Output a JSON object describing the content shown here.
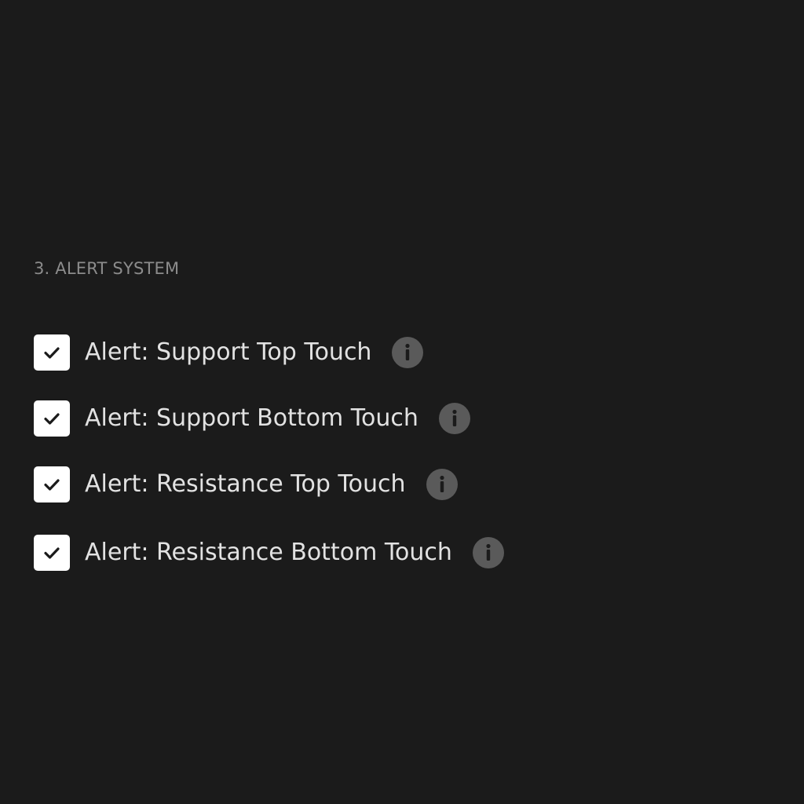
{
  "section": {
    "title": "3. ALERT SYSTEM"
  },
  "alerts": [
    {
      "label": "Alert: Support Top Touch",
      "checked": true,
      "info_icon": "info-icon"
    },
    {
      "label": "Alert: Support Bottom Touch",
      "checked": true,
      "info_icon": "info-icon"
    },
    {
      "label": "Alert: Resistance Top Touch",
      "checked": true,
      "info_icon": "info-icon"
    },
    {
      "label": "Alert: Resistance Bottom Touch",
      "checked": true,
      "info_icon": "info-icon"
    }
  ],
  "colors": {
    "background": "#1b1b1b",
    "section_title": "#8c8c8c",
    "label_text": "#e2e2e2",
    "checkbox_fill": "#ffffff",
    "checkmark": "#1b1b1b",
    "info_icon": "#5a5a5a"
  }
}
